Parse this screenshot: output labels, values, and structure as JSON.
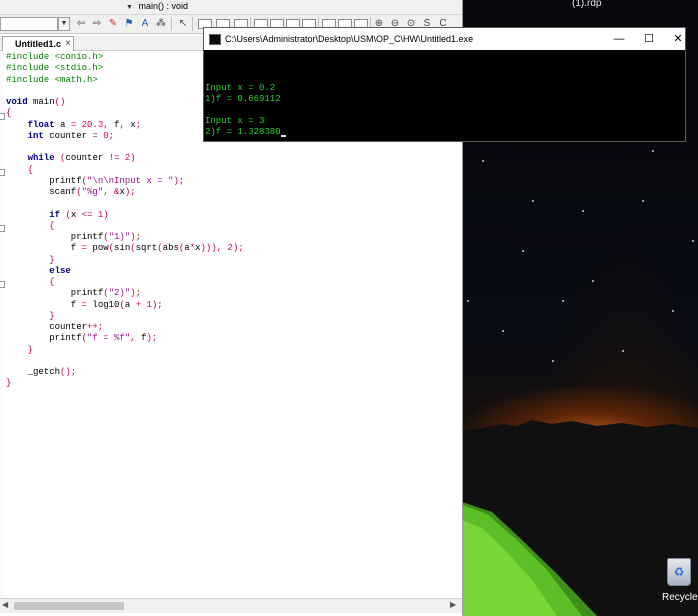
{
  "ide": {
    "function_combo": "main() : void",
    "tab_label": "Untitled1.c",
    "tab_close": "×",
    "code_lines": [
      "#include <conio.h>",
      "#include <stdio.h>",
      "#include <math.h>",
      "",
      "void main()",
      "{",
      "    float a = 20.3, f, x;",
      "    int counter = 0;",
      "",
      "    while (counter != 2)",
      "    {",
      "        printf(\"\\n\\nInput x = \");",
      "        scanf(\"%g\", &x);",
      "",
      "        if (x <= 1)",
      "        {",
      "            printf(\"1)\");",
      "            f = pow(sin(sqrt(abs(a*x))), 2);",
      "        }",
      "        else",
      "        {",
      "            printf(\"2)\");",
      "            f = log10(a + 1);",
      "        }",
      "        counter++;",
      "        printf(\"f = %f\", f);",
      "    }",
      "",
      "    _getch();",
      "}"
    ]
  },
  "console": {
    "title": "C:\\Users\\Administrator\\Desktop\\USM\\OP_C\\HW\\Untitled1.exe",
    "minimize": "—",
    "maximize": "☐",
    "close": "✕",
    "lines": [
      "",
      "",
      "",
      "Input x = 0.2",
      "1)f = 0.669112",
      "",
      "Input x = 3",
      "2)f = 1.328380"
    ]
  },
  "desktop": {
    "rdp_label": "(1).rdp",
    "recycle_label": "Recycle"
  },
  "colors": {
    "console_text": "#2fcf2f",
    "preprocessor": "#008000",
    "keyword": "#00008b",
    "string": "#a0128e",
    "number": "#e0004a"
  }
}
